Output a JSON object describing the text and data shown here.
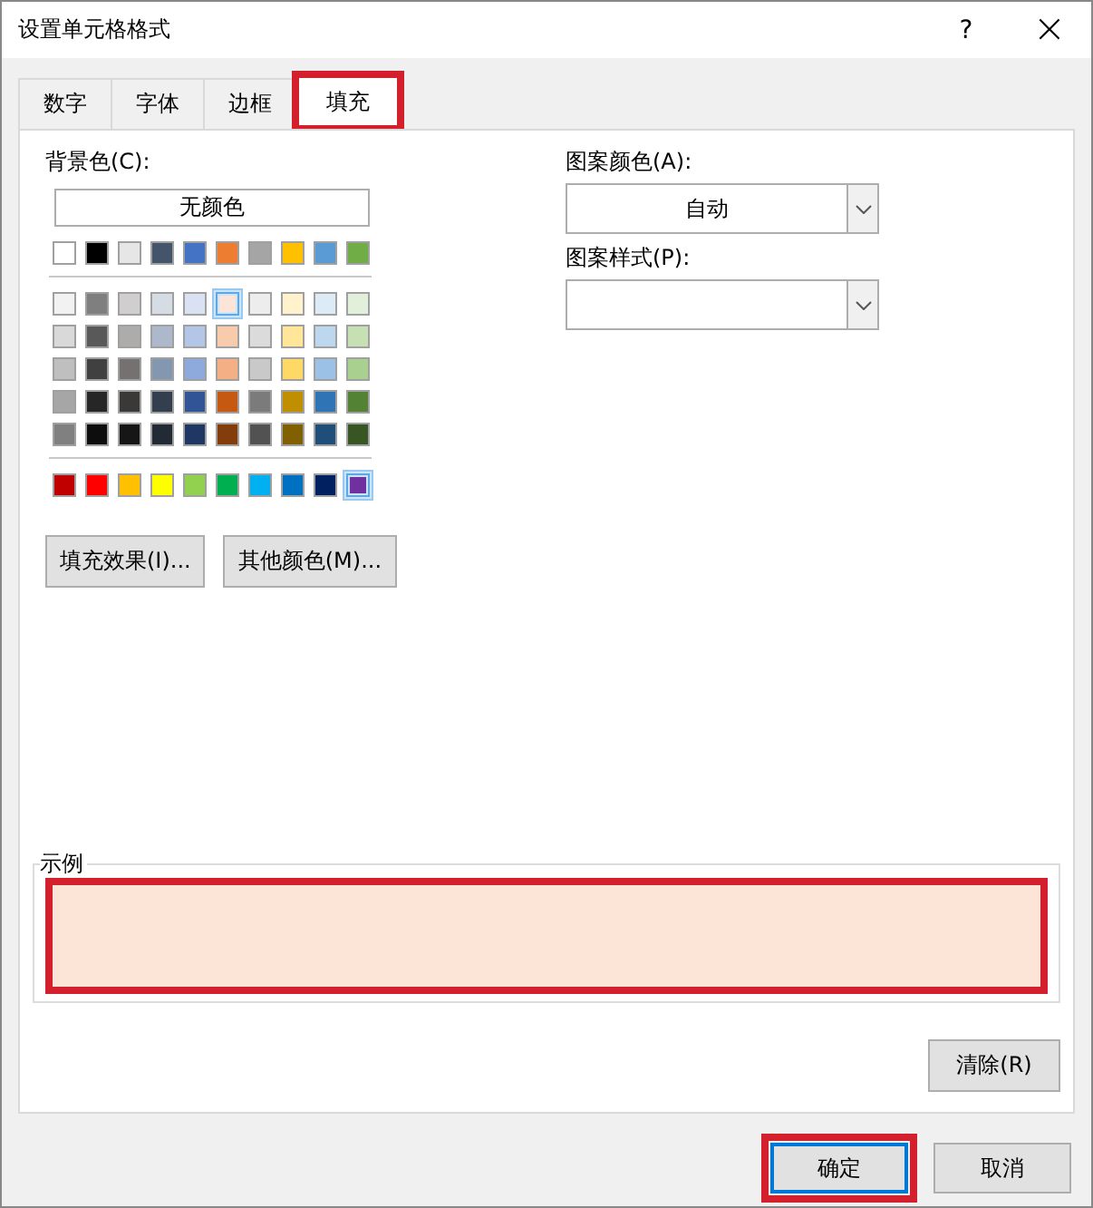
{
  "window": {
    "title": "设置单元格格式",
    "help": "?",
    "close": "×"
  },
  "tabs": [
    {
      "label": "数字",
      "selected": false,
      "highlighted": false
    },
    {
      "label": "字体",
      "selected": false,
      "highlighted": false
    },
    {
      "label": "边框",
      "selected": false,
      "highlighted": false
    },
    {
      "label": "填充",
      "selected": true,
      "highlighted": true
    }
  ],
  "background": {
    "label": "背景色(C):",
    "no_color": "无颜色",
    "groups": [
      [
        [
          {
            "color": "#ffffff",
            "selected": false
          },
          {
            "color": "#000000",
            "selected": false
          },
          {
            "color": "#e7e6e6",
            "selected": false
          },
          {
            "color": "#44546a",
            "selected": false
          },
          {
            "color": "#4472c4",
            "selected": false
          },
          {
            "color": "#ed7d31",
            "selected": false
          },
          {
            "color": "#a5a5a5",
            "selected": false
          },
          {
            "color": "#ffc000",
            "selected": false
          },
          {
            "color": "#5b9bd5",
            "selected": false
          },
          {
            "color": "#70ad47",
            "selected": false
          }
        ]
      ],
      [
        [
          {
            "color": "#f2f2f2",
            "selected": false
          },
          {
            "color": "#7f7f7f",
            "selected": false
          },
          {
            "color": "#d0cece",
            "selected": false
          },
          {
            "color": "#d6dce4",
            "selected": false
          },
          {
            "color": "#d9e1f2",
            "selected": false
          },
          {
            "color": "#fce4d6",
            "selected": true
          },
          {
            "color": "#ededed",
            "selected": false
          },
          {
            "color": "#fff2cc",
            "selected": false
          },
          {
            "color": "#ddebf7",
            "selected": false
          },
          {
            "color": "#e2efda",
            "selected": false
          }
        ],
        [
          {
            "color": "#d9d9d9",
            "selected": false
          },
          {
            "color": "#595959",
            "selected": false
          },
          {
            "color": "#aeabab",
            "selected": false
          },
          {
            "color": "#adb9ca",
            "selected": false
          },
          {
            "color": "#b4c6e7",
            "selected": false
          },
          {
            "color": "#f8cbad",
            "selected": false
          },
          {
            "color": "#dbdbdb",
            "selected": false
          },
          {
            "color": "#ffe699",
            "selected": false
          },
          {
            "color": "#bdd7ee",
            "selected": false
          },
          {
            "color": "#c6e0b4",
            "selected": false
          }
        ],
        [
          {
            "color": "#bfbfbf",
            "selected": false
          },
          {
            "color": "#404040",
            "selected": false
          },
          {
            "color": "#757171",
            "selected": false
          },
          {
            "color": "#8497b0",
            "selected": false
          },
          {
            "color": "#8ea9db",
            "selected": false
          },
          {
            "color": "#f4b084",
            "selected": false
          },
          {
            "color": "#c9c9c9",
            "selected": false
          },
          {
            "color": "#ffd966",
            "selected": false
          },
          {
            "color": "#9bc2e6",
            "selected": false
          },
          {
            "color": "#a9d08e",
            "selected": false
          }
        ],
        [
          {
            "color": "#a6a6a6",
            "selected": false
          },
          {
            "color": "#262626",
            "selected": false
          },
          {
            "color": "#3b3838",
            "selected": false
          },
          {
            "color": "#333f4f",
            "selected": false
          },
          {
            "color": "#305496",
            "selected": false
          },
          {
            "color": "#c65911",
            "selected": false
          },
          {
            "color": "#7b7b7b",
            "selected": false
          },
          {
            "color": "#bf8f00",
            "selected": false
          },
          {
            "color": "#2f75b5",
            "selected": false
          },
          {
            "color": "#548235",
            "selected": false
          }
        ],
        [
          {
            "color": "#808080",
            "selected": false
          },
          {
            "color": "#0d0d0d",
            "selected": false
          },
          {
            "color": "#161616",
            "selected": false
          },
          {
            "color": "#222b35",
            "selected": false
          },
          {
            "color": "#203764",
            "selected": false
          },
          {
            "color": "#833c0b",
            "selected": false
          },
          {
            "color": "#525252",
            "selected": false
          },
          {
            "color": "#806000",
            "selected": false
          },
          {
            "color": "#1f4e78",
            "selected": false
          },
          {
            "color": "#375623",
            "selected": false
          }
        ]
      ],
      [
        [
          {
            "color": "#c00000",
            "selected": false
          },
          {
            "color": "#ff0000",
            "selected": false
          },
          {
            "color": "#ffc000",
            "selected": false
          },
          {
            "color": "#ffff00",
            "selected": false
          },
          {
            "color": "#92d050",
            "selected": false
          },
          {
            "color": "#00b050",
            "selected": false
          },
          {
            "color": "#00b0f0",
            "selected": false
          },
          {
            "color": "#0070c0",
            "selected": false
          },
          {
            "color": "#002060",
            "selected": false
          },
          {
            "color": "#7030a0",
            "selected": true
          }
        ]
      ]
    ],
    "buttons": [
      "填充效果(I)...",
      "其他颜色(M)..."
    ]
  },
  "pattern_color": {
    "label": "图案颜色(A):",
    "value": "自动"
  },
  "pattern_style": {
    "label": "图案样式(P):"
  },
  "sample": {
    "label": "示例",
    "color": "#fce4d6",
    "highlighted": true
  },
  "clear_button": "清除(R)",
  "footer_buttons": [
    {
      "label": "确定",
      "default": true,
      "highlighted": true
    },
    {
      "label": "取消",
      "default": false,
      "highlighted": false
    }
  ]
}
